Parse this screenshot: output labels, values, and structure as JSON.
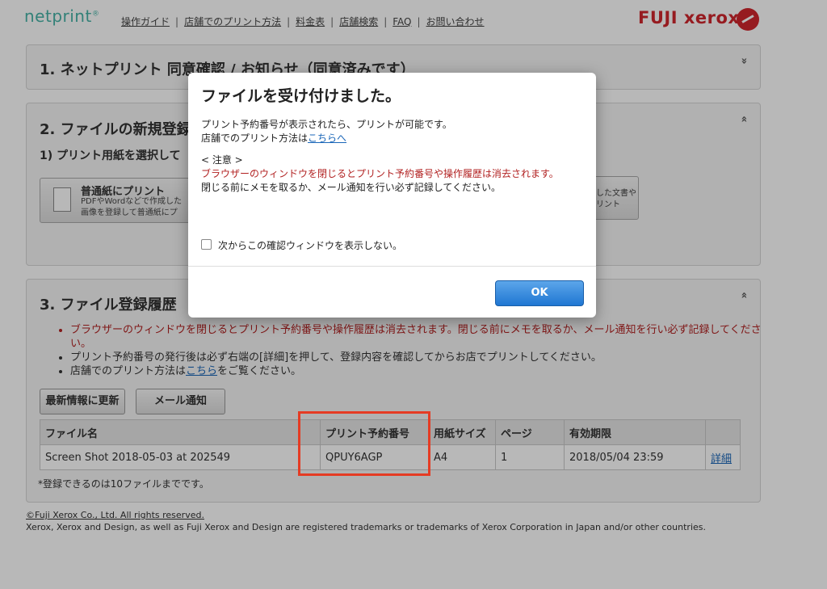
{
  "header": {
    "logo": "netprint",
    "logo_mark": "®",
    "nav": [
      "操作ガイド",
      "店舗でのプリント方法",
      "料金表",
      "店舗検索",
      "FAQ",
      "お問い合わせ"
    ],
    "brand": "FUJI xerox"
  },
  "panel1": {
    "title": "1. ネットプリント 同意確認 / お知らせ（同意済みです）",
    "chevron": "»"
  },
  "panel2": {
    "title": "2. ファイルの新規登録",
    "subtitle": "1) プリント用紙を選択して",
    "plain_paper": {
      "title": "普通紙にプリント",
      "line1": "PDFやWordなどで作成した",
      "line2": "画像を登録して普通紙にプ"
    },
    "right_button": {
      "line1": "した文書や",
      "line2": "リント"
    },
    "chevron": "«"
  },
  "panel3": {
    "title": "3. ファイル登録履歴",
    "chevron": "«",
    "notes": {
      "n1": "ブラウザーのウィンドウを閉じるとプリント予約番号や操作履歴は消去されます。閉じる前にメモを取るか、メール通知を行い必ず記録してください。",
      "n2": "プリント予約番号の発行後は必ず右端の[詳細]を押して、登録内容を確認してからお店でプリントしてください。",
      "n3_pre": "店舗でのプリント方法は",
      "n3_link": "こちら",
      "n3_post": "をご覧ください。"
    },
    "refresh_button": "最新情報に更新",
    "mail_button": "メール通知",
    "table": {
      "headers": [
        "ファイル名",
        "プリント予約番号",
        "用紙サイズ",
        "ページ",
        "有効期限",
        ""
      ],
      "rows": [
        [
          "Screen Shot 2018-05-03 at 202549",
          "QPUY6AGP",
          "A4",
          "1",
          "2018/05/04 23:59",
          "詳細"
        ]
      ]
    },
    "limit_note": "*登録できるのは10ファイルまでです。"
  },
  "footer": {
    "copyright": "©Fuji Xerox Co., Ltd. All rights reserved.",
    "trademark": "Xerox, Xerox and Design, as well as Fuji Xerox and Design are registered trademarks or trademarks of Xerox Corporation in Japan and/or other countries."
  },
  "dialog": {
    "title": "ファイルを受け付けました。",
    "line1": "プリント予約番号が表示されたら、プリントが可能です。",
    "line2_pre": "店舗でのプリント方法は",
    "line2_link": "こちらへ",
    "caution": "< 注意 >",
    "warning": "ブラウザーのウィンドウを閉じるとプリント予約番号や操作履歴は消去されます。",
    "advice": "閉じる前にメモを取るか、メール通知を行い必ず記録してください。",
    "checkbox_label": "次からこの確認ウィンドウを表示しない。",
    "ok_label": "OK"
  },
  "colors": {
    "brand_teal": "#47b3a7",
    "brand_red": "#d0262d",
    "warning_red": "#b22222",
    "link_blue": "#1a66b8",
    "highlight": "#e53b23"
  }
}
